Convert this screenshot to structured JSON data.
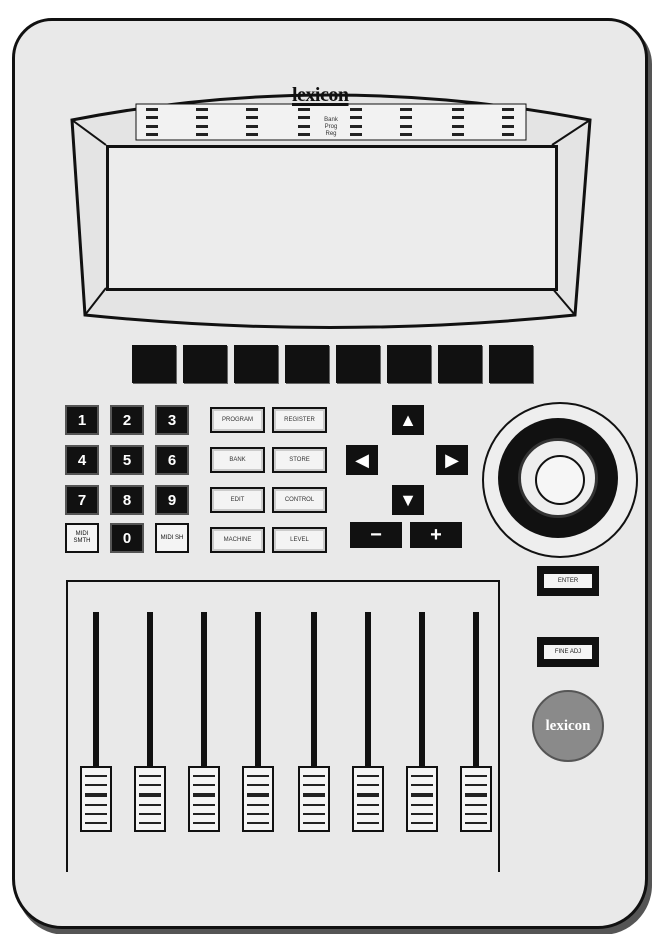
{
  "brand": {
    "name": "lexicon",
    "badge": "lexicon"
  },
  "display": {
    "mode_labels": [
      "Bank",
      "Prog",
      "Reg"
    ]
  },
  "keypad": {
    "digits": [
      "1",
      "2",
      "3",
      "4",
      "5",
      "6",
      "7",
      "8",
      "9",
      "0"
    ],
    "left_special": "MIDI SMTH",
    "right_special": "MIDI SH"
  },
  "function_keys": [
    "PROGRAM",
    "REGISTER",
    "BANK",
    "STORE",
    "EDIT",
    "CONTROL",
    "MACHINE",
    "LEVEL"
  ],
  "navigation": {
    "up": "▲",
    "left": "◀",
    "right": "▶",
    "down": "▼",
    "minus": "−",
    "plus": "+"
  },
  "side_buttons": [
    "ENTER",
    "FINE ADJ"
  ],
  "faders": {
    "count": 8
  }
}
